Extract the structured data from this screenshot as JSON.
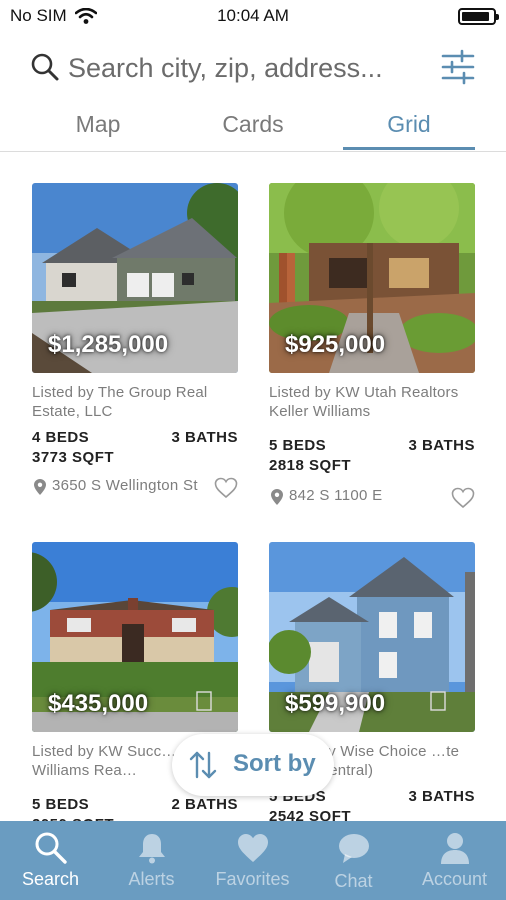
{
  "status_bar": {
    "carrier": "No SIM",
    "time": "10:04 AM"
  },
  "search": {
    "placeholder": "Search city, zip, address..."
  },
  "tabs": [
    {
      "label": "Map",
      "active": false
    },
    {
      "label": "Cards",
      "active": false
    },
    {
      "label": "Grid",
      "active": true
    }
  ],
  "listings": [
    {
      "price": "$1,285,000",
      "listed_by": "Listed by The Group Real Estate, LLC",
      "beds": "4 BEDS",
      "baths": "3 BATHS",
      "sqft": "3773 SQFT",
      "address": "3650 S Wellington St"
    },
    {
      "price": "$925,000",
      "listed_by": "Listed by KW Utah Realtors Keller Williams",
      "beds": "5 BEDS",
      "baths": "3 BATHS",
      "sqft": "2818 SQFT",
      "address": "842 S 1100 E"
    },
    {
      "price": "$435,000",
      "listed_by": "Listed by KW Succ… Keller Williams Rea…",
      "beds": "5 BEDS",
      "baths": "2 BATHS",
      "sqft": "2050 SQFT",
      "address": ""
    },
    {
      "price": "$599,900",
      "listed_by": "…y Wise Choice …te (Central)",
      "beds": "5 BEDS",
      "baths": "3 BATHS",
      "sqft": "2542 SQFT",
      "address": ""
    }
  ],
  "sort": {
    "label": "Sort by"
  },
  "bottom_nav": [
    {
      "label": "Search",
      "icon": "search-icon",
      "active": true
    },
    {
      "label": "Alerts",
      "icon": "bell-icon",
      "active": false
    },
    {
      "label": "Favorites",
      "icon": "heart-icon",
      "active": false
    },
    {
      "label": "Chat",
      "icon": "chat-icon",
      "active": false
    },
    {
      "label": "Account",
      "icon": "person-icon",
      "active": false
    }
  ],
  "colors": {
    "accent": "#5b8db1",
    "nav_bg": "#6a9cc1"
  }
}
